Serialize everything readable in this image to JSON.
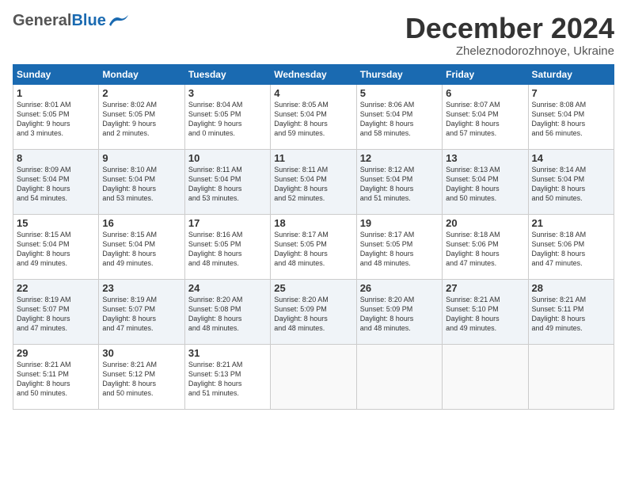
{
  "header": {
    "logo_general": "General",
    "logo_blue": "Blue",
    "month_title": "December 2024",
    "subtitle": "Zheleznodorozhnoye, Ukraine"
  },
  "days_of_week": [
    "Sunday",
    "Monday",
    "Tuesday",
    "Wednesday",
    "Thursday",
    "Friday",
    "Saturday"
  ],
  "weeks": [
    [
      {
        "day": "1",
        "info": "Sunrise: 8:01 AM\nSunset: 5:05 PM\nDaylight: 9 hours\nand 3 minutes."
      },
      {
        "day": "2",
        "info": "Sunrise: 8:02 AM\nSunset: 5:05 PM\nDaylight: 9 hours\nand 2 minutes."
      },
      {
        "day": "3",
        "info": "Sunrise: 8:04 AM\nSunset: 5:05 PM\nDaylight: 9 hours\nand 0 minutes."
      },
      {
        "day": "4",
        "info": "Sunrise: 8:05 AM\nSunset: 5:04 PM\nDaylight: 8 hours\nand 59 minutes."
      },
      {
        "day": "5",
        "info": "Sunrise: 8:06 AM\nSunset: 5:04 PM\nDaylight: 8 hours\nand 58 minutes."
      },
      {
        "day": "6",
        "info": "Sunrise: 8:07 AM\nSunset: 5:04 PM\nDaylight: 8 hours\nand 57 minutes."
      },
      {
        "day": "7",
        "info": "Sunrise: 8:08 AM\nSunset: 5:04 PM\nDaylight: 8 hours\nand 56 minutes."
      }
    ],
    [
      {
        "day": "8",
        "info": "Sunrise: 8:09 AM\nSunset: 5:04 PM\nDaylight: 8 hours\nand 54 minutes."
      },
      {
        "day": "9",
        "info": "Sunrise: 8:10 AM\nSunset: 5:04 PM\nDaylight: 8 hours\nand 53 minutes."
      },
      {
        "day": "10",
        "info": "Sunrise: 8:11 AM\nSunset: 5:04 PM\nDaylight: 8 hours\nand 53 minutes."
      },
      {
        "day": "11",
        "info": "Sunrise: 8:11 AM\nSunset: 5:04 PM\nDaylight: 8 hours\nand 52 minutes."
      },
      {
        "day": "12",
        "info": "Sunrise: 8:12 AM\nSunset: 5:04 PM\nDaylight: 8 hours\nand 51 minutes."
      },
      {
        "day": "13",
        "info": "Sunrise: 8:13 AM\nSunset: 5:04 PM\nDaylight: 8 hours\nand 50 minutes."
      },
      {
        "day": "14",
        "info": "Sunrise: 8:14 AM\nSunset: 5:04 PM\nDaylight: 8 hours\nand 50 minutes."
      }
    ],
    [
      {
        "day": "15",
        "info": "Sunrise: 8:15 AM\nSunset: 5:04 PM\nDaylight: 8 hours\nand 49 minutes."
      },
      {
        "day": "16",
        "info": "Sunrise: 8:15 AM\nSunset: 5:04 PM\nDaylight: 8 hours\nand 49 minutes."
      },
      {
        "day": "17",
        "info": "Sunrise: 8:16 AM\nSunset: 5:05 PM\nDaylight: 8 hours\nand 48 minutes."
      },
      {
        "day": "18",
        "info": "Sunrise: 8:17 AM\nSunset: 5:05 PM\nDaylight: 8 hours\nand 48 minutes."
      },
      {
        "day": "19",
        "info": "Sunrise: 8:17 AM\nSunset: 5:05 PM\nDaylight: 8 hours\nand 48 minutes."
      },
      {
        "day": "20",
        "info": "Sunrise: 8:18 AM\nSunset: 5:06 PM\nDaylight: 8 hours\nand 47 minutes."
      },
      {
        "day": "21",
        "info": "Sunrise: 8:18 AM\nSunset: 5:06 PM\nDaylight: 8 hours\nand 47 minutes."
      }
    ],
    [
      {
        "day": "22",
        "info": "Sunrise: 8:19 AM\nSunset: 5:07 PM\nDaylight: 8 hours\nand 47 minutes."
      },
      {
        "day": "23",
        "info": "Sunrise: 8:19 AM\nSunset: 5:07 PM\nDaylight: 8 hours\nand 47 minutes."
      },
      {
        "day": "24",
        "info": "Sunrise: 8:20 AM\nSunset: 5:08 PM\nDaylight: 8 hours\nand 48 minutes."
      },
      {
        "day": "25",
        "info": "Sunrise: 8:20 AM\nSunset: 5:09 PM\nDaylight: 8 hours\nand 48 minutes."
      },
      {
        "day": "26",
        "info": "Sunrise: 8:20 AM\nSunset: 5:09 PM\nDaylight: 8 hours\nand 48 minutes."
      },
      {
        "day": "27",
        "info": "Sunrise: 8:21 AM\nSunset: 5:10 PM\nDaylight: 8 hours\nand 49 minutes."
      },
      {
        "day": "28",
        "info": "Sunrise: 8:21 AM\nSunset: 5:11 PM\nDaylight: 8 hours\nand 49 minutes."
      }
    ],
    [
      {
        "day": "29",
        "info": "Sunrise: 8:21 AM\nSunset: 5:11 PM\nDaylight: 8 hours\nand 50 minutes."
      },
      {
        "day": "30",
        "info": "Sunrise: 8:21 AM\nSunset: 5:12 PM\nDaylight: 8 hours\nand 50 minutes."
      },
      {
        "day": "31",
        "info": "Sunrise: 8:21 AM\nSunset: 5:13 PM\nDaylight: 8 hours\nand 51 minutes."
      },
      {
        "day": "",
        "info": ""
      },
      {
        "day": "",
        "info": ""
      },
      {
        "day": "",
        "info": ""
      },
      {
        "day": "",
        "info": ""
      }
    ]
  ]
}
